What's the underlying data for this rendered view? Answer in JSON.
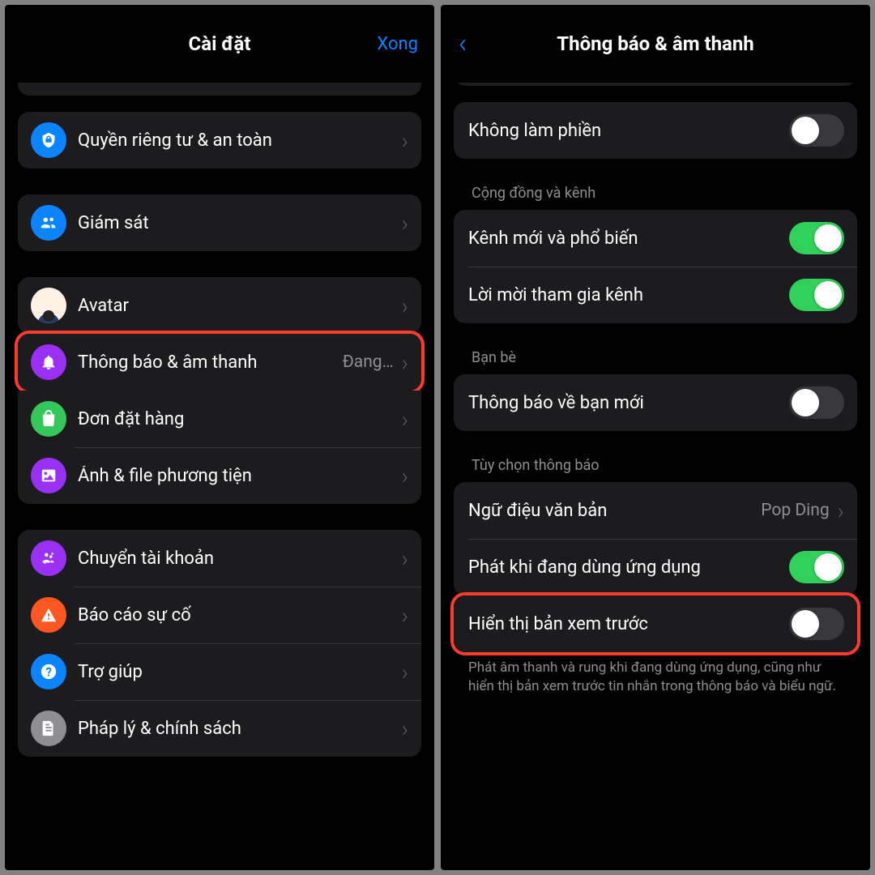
{
  "left": {
    "title": "Cài đặt",
    "done": "Xong",
    "items": {
      "privacy": "Quyền riêng tư & an toàn",
      "supervision": "Giám sát",
      "avatar": "Avatar",
      "notifications": {
        "label": "Thông báo & âm thanh",
        "detail": "Đang…"
      },
      "orders": "Đơn đặt hàng",
      "media": "Ảnh & file phương tiện",
      "switch": "Chuyển tài khoản",
      "report": "Báo cáo sự cố",
      "help": "Trợ giúp",
      "legal": "Pháp lý & chính sách"
    }
  },
  "right": {
    "title": "Thông báo & âm thanh",
    "dnd": "Không làm phiền",
    "sections": {
      "community": {
        "header": "Cộng đồng và kênh",
        "new_channels": "Kênh mới và phổ biến",
        "invites": "Lời mời tham gia kênh"
      },
      "friends": {
        "header": "Bạn bè",
        "new_friend": "Thông báo về bạn mới"
      },
      "options": {
        "header": "Tùy chọn thông báo",
        "tone": {
          "label": "Ngữ điệu văn bản",
          "value": "Pop Ding"
        },
        "in_app": "Phát khi đang dùng ứng dụng",
        "preview": "Hiển thị bản xem trước",
        "footer": "Phát âm thanh và rung khi đang dùng ứng dụng, cũng như hiển thị bản xem trước tin nhắn trong thông báo và biểu ngữ."
      }
    }
  },
  "colors": {
    "blue": "#0a84ff",
    "purple": "#9f35f0",
    "green": "#30d158",
    "orange": "#ff5722",
    "gray": "#8e8e93",
    "iconBlue": "#0a84ff",
    "iconGreen": "#34c759",
    "iconPurple": "#9b30f5"
  }
}
